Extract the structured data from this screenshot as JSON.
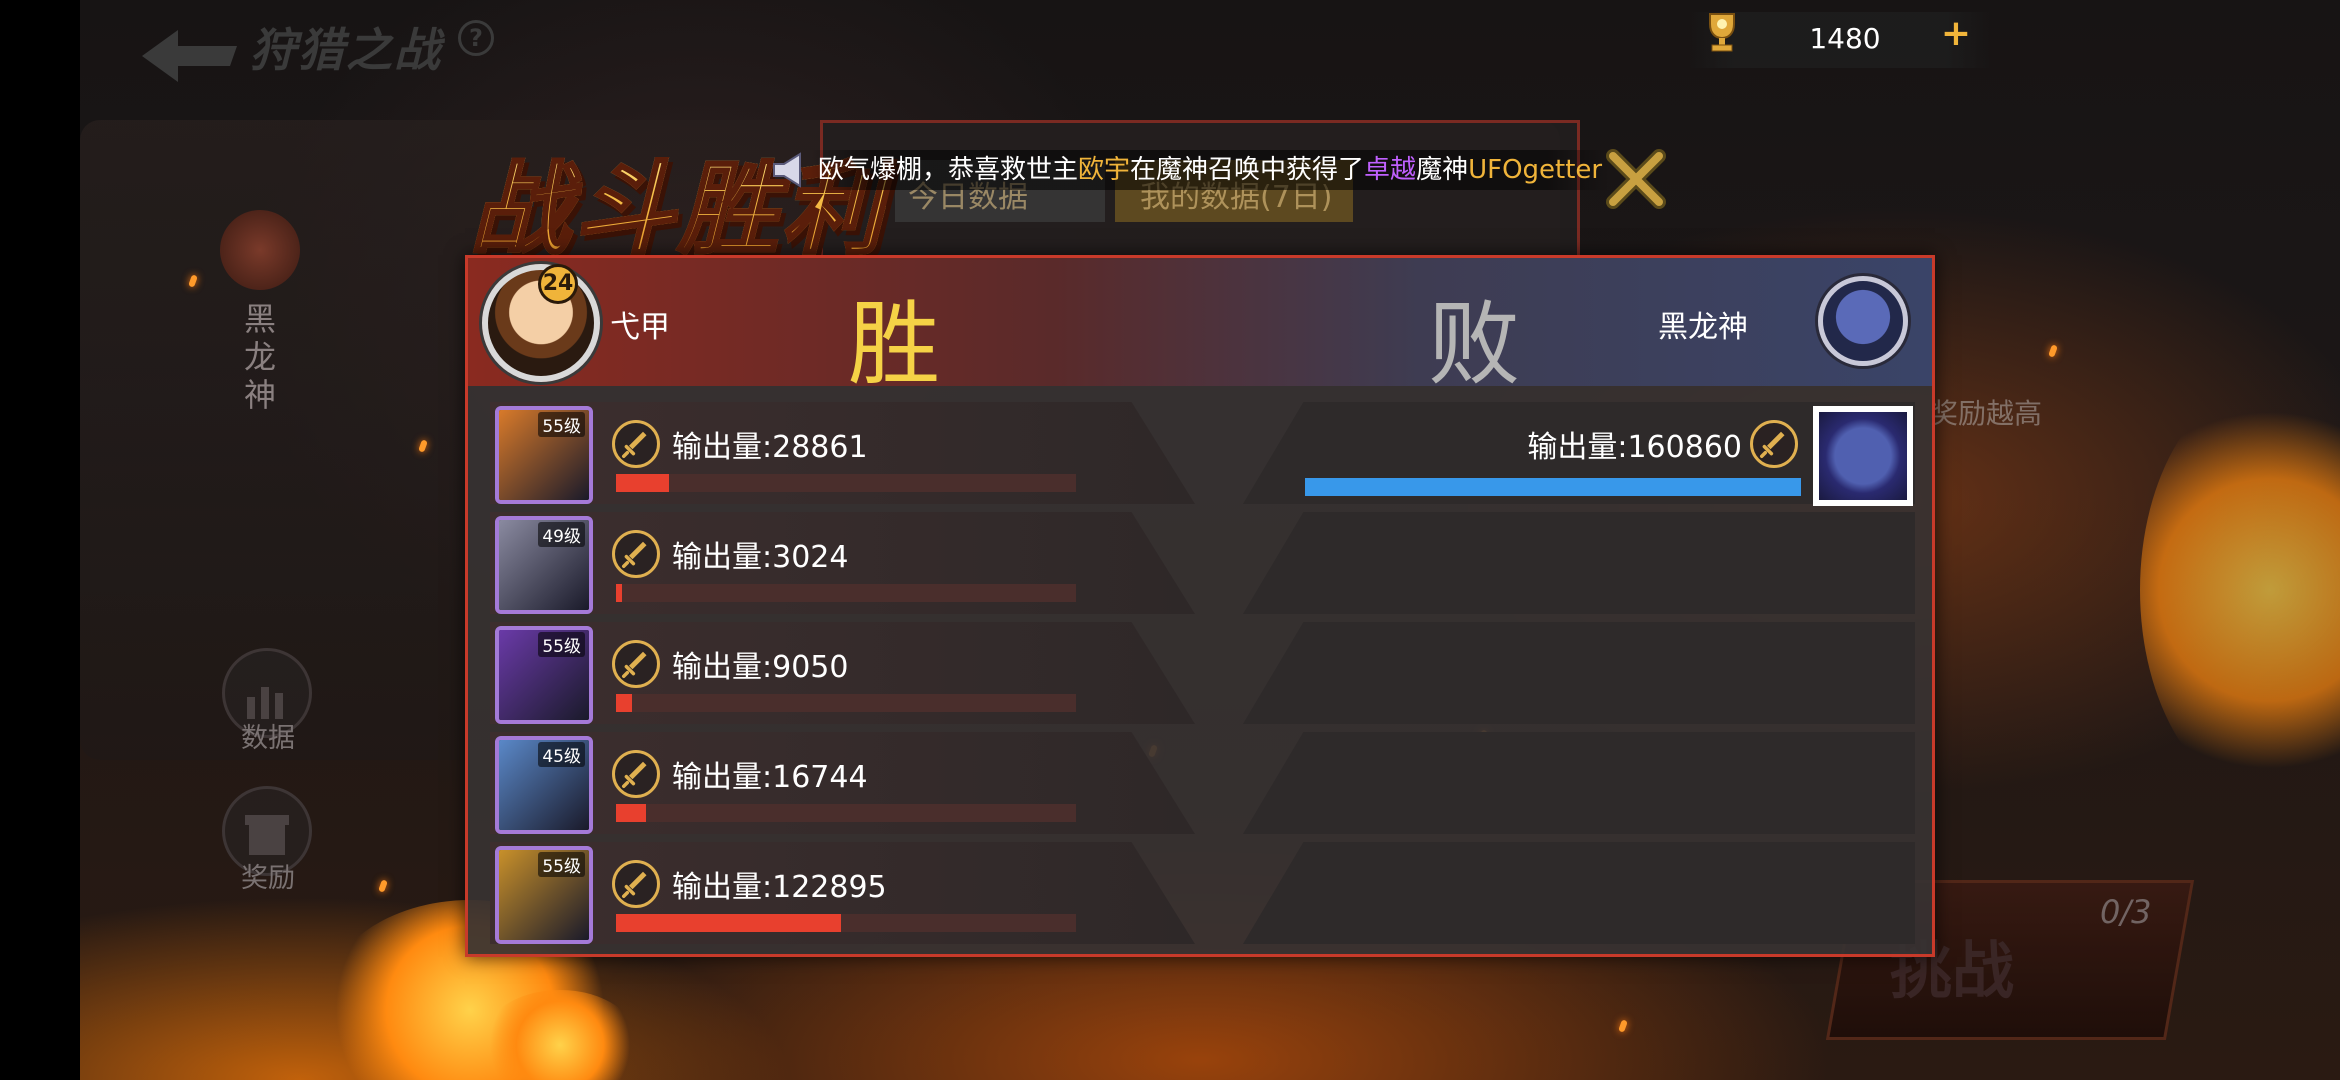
{
  "header": {
    "title": "狩猎之战",
    "help_icon": "?",
    "currency": {
      "icon": "trophy-icon",
      "value": "1480",
      "add": "+"
    }
  },
  "sidebar": {
    "boss_label": "黑龙神",
    "data_button": "数据",
    "reward_button": "奖励"
  },
  "background": {
    "tab_my_data": "我的数据(7日)",
    "tab_day_data": "今日数据",
    "hint": "奖励越高",
    "challenge_label": "挑战",
    "challenge_count": "0/3"
  },
  "victory_title": "战斗胜利",
  "broadcast": {
    "prefix": "欧气爆棚，恭喜救世主",
    "player": "欧宇",
    "middle": "在魔神召唤中获得了",
    "rarity": "卓越",
    "suffix": "魔神",
    "item": "UFOgetter"
  },
  "battle": {
    "player_name": "弋甲",
    "player_level": "24",
    "win_label": "胜",
    "lose_label": "败",
    "enemy_name": "黑龙神",
    "damage_prefix": "输出量:",
    "player_units": [
      {
        "level": "55级",
        "damage": "28861",
        "fraction": 0.115,
        "frame": "#a57ad8",
        "tint": "#d87a2a"
      },
      {
        "level": "49级",
        "damage": "3024",
        "fraction": 0.012,
        "frame": "#a57ad8",
        "tint": "#8a8aa0"
      },
      {
        "level": "55级",
        "damage": "9050",
        "fraction": 0.035,
        "frame": "#a57ad8",
        "tint": "#6a3aa8"
      },
      {
        "level": "45级",
        "damage": "16744",
        "fraction": 0.065,
        "frame": "#a57ad8",
        "tint": "#5a88c8"
      },
      {
        "level": "55级",
        "damage": "122895",
        "fraction": 0.49,
        "frame": "#a57ad8",
        "tint": "#c8902a"
      }
    ],
    "enemy_unit": {
      "damage": "160860",
      "fraction": 1.0
    }
  },
  "colors": {
    "panel_border": "#c83a2a",
    "player_bar": "#e8402e",
    "enemy_bar": "#3898ea",
    "gold": "#f0b43a",
    "win": "#f5d246"
  }
}
